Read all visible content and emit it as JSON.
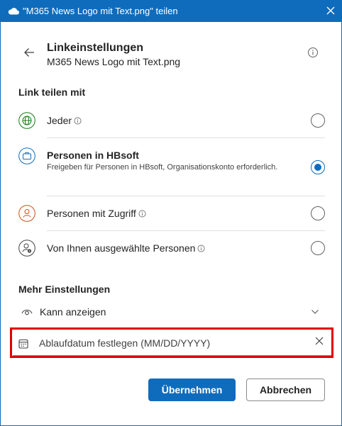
{
  "window": {
    "title": "\"M365 News Logo mit Text.png\" teilen",
    "accent_color": "#0f6cbd",
    "icons": {
      "app": "onedrive-cloud-icon",
      "close": "close-icon"
    }
  },
  "header": {
    "title": "Linkeinstellungen",
    "subtitle": "M365 News Logo mit Text.png",
    "icons": {
      "back": "back-arrow-icon",
      "info": "info-icon"
    }
  },
  "share_with": {
    "label": "Link teilen mit",
    "options": [
      {
        "label": "Jeder",
        "description": "",
        "has_info": true,
        "icon": "globe-icon",
        "selected": false
      },
      {
        "label": "Personen in HBsoft",
        "description": "Freigeben für Personen in HBsoft, Organisationskonto erforderlich.",
        "has_info": false,
        "icon": "briefcase-icon",
        "selected": true
      },
      {
        "label": "Personen mit Zugriff",
        "description": "",
        "has_info": true,
        "icon": "person-icon",
        "selected": false
      },
      {
        "label": "Von Ihnen ausgewählte Personen",
        "description": "",
        "has_info": true,
        "icon": "person-settings-icon",
        "selected": false
      }
    ]
  },
  "more_settings": {
    "label": "Mehr Einstellungen",
    "permission": {
      "label": "Kann anzeigen",
      "icon": "eye-icon"
    },
    "expiration": {
      "placeholder": "Ablaufdatum festlegen (MM/DD/YYYY)",
      "value": "",
      "icon": "calendar-icon",
      "highlight_color": "#e00000"
    }
  },
  "footer": {
    "apply_label": "Übernehmen",
    "cancel_label": "Abbrechen"
  }
}
